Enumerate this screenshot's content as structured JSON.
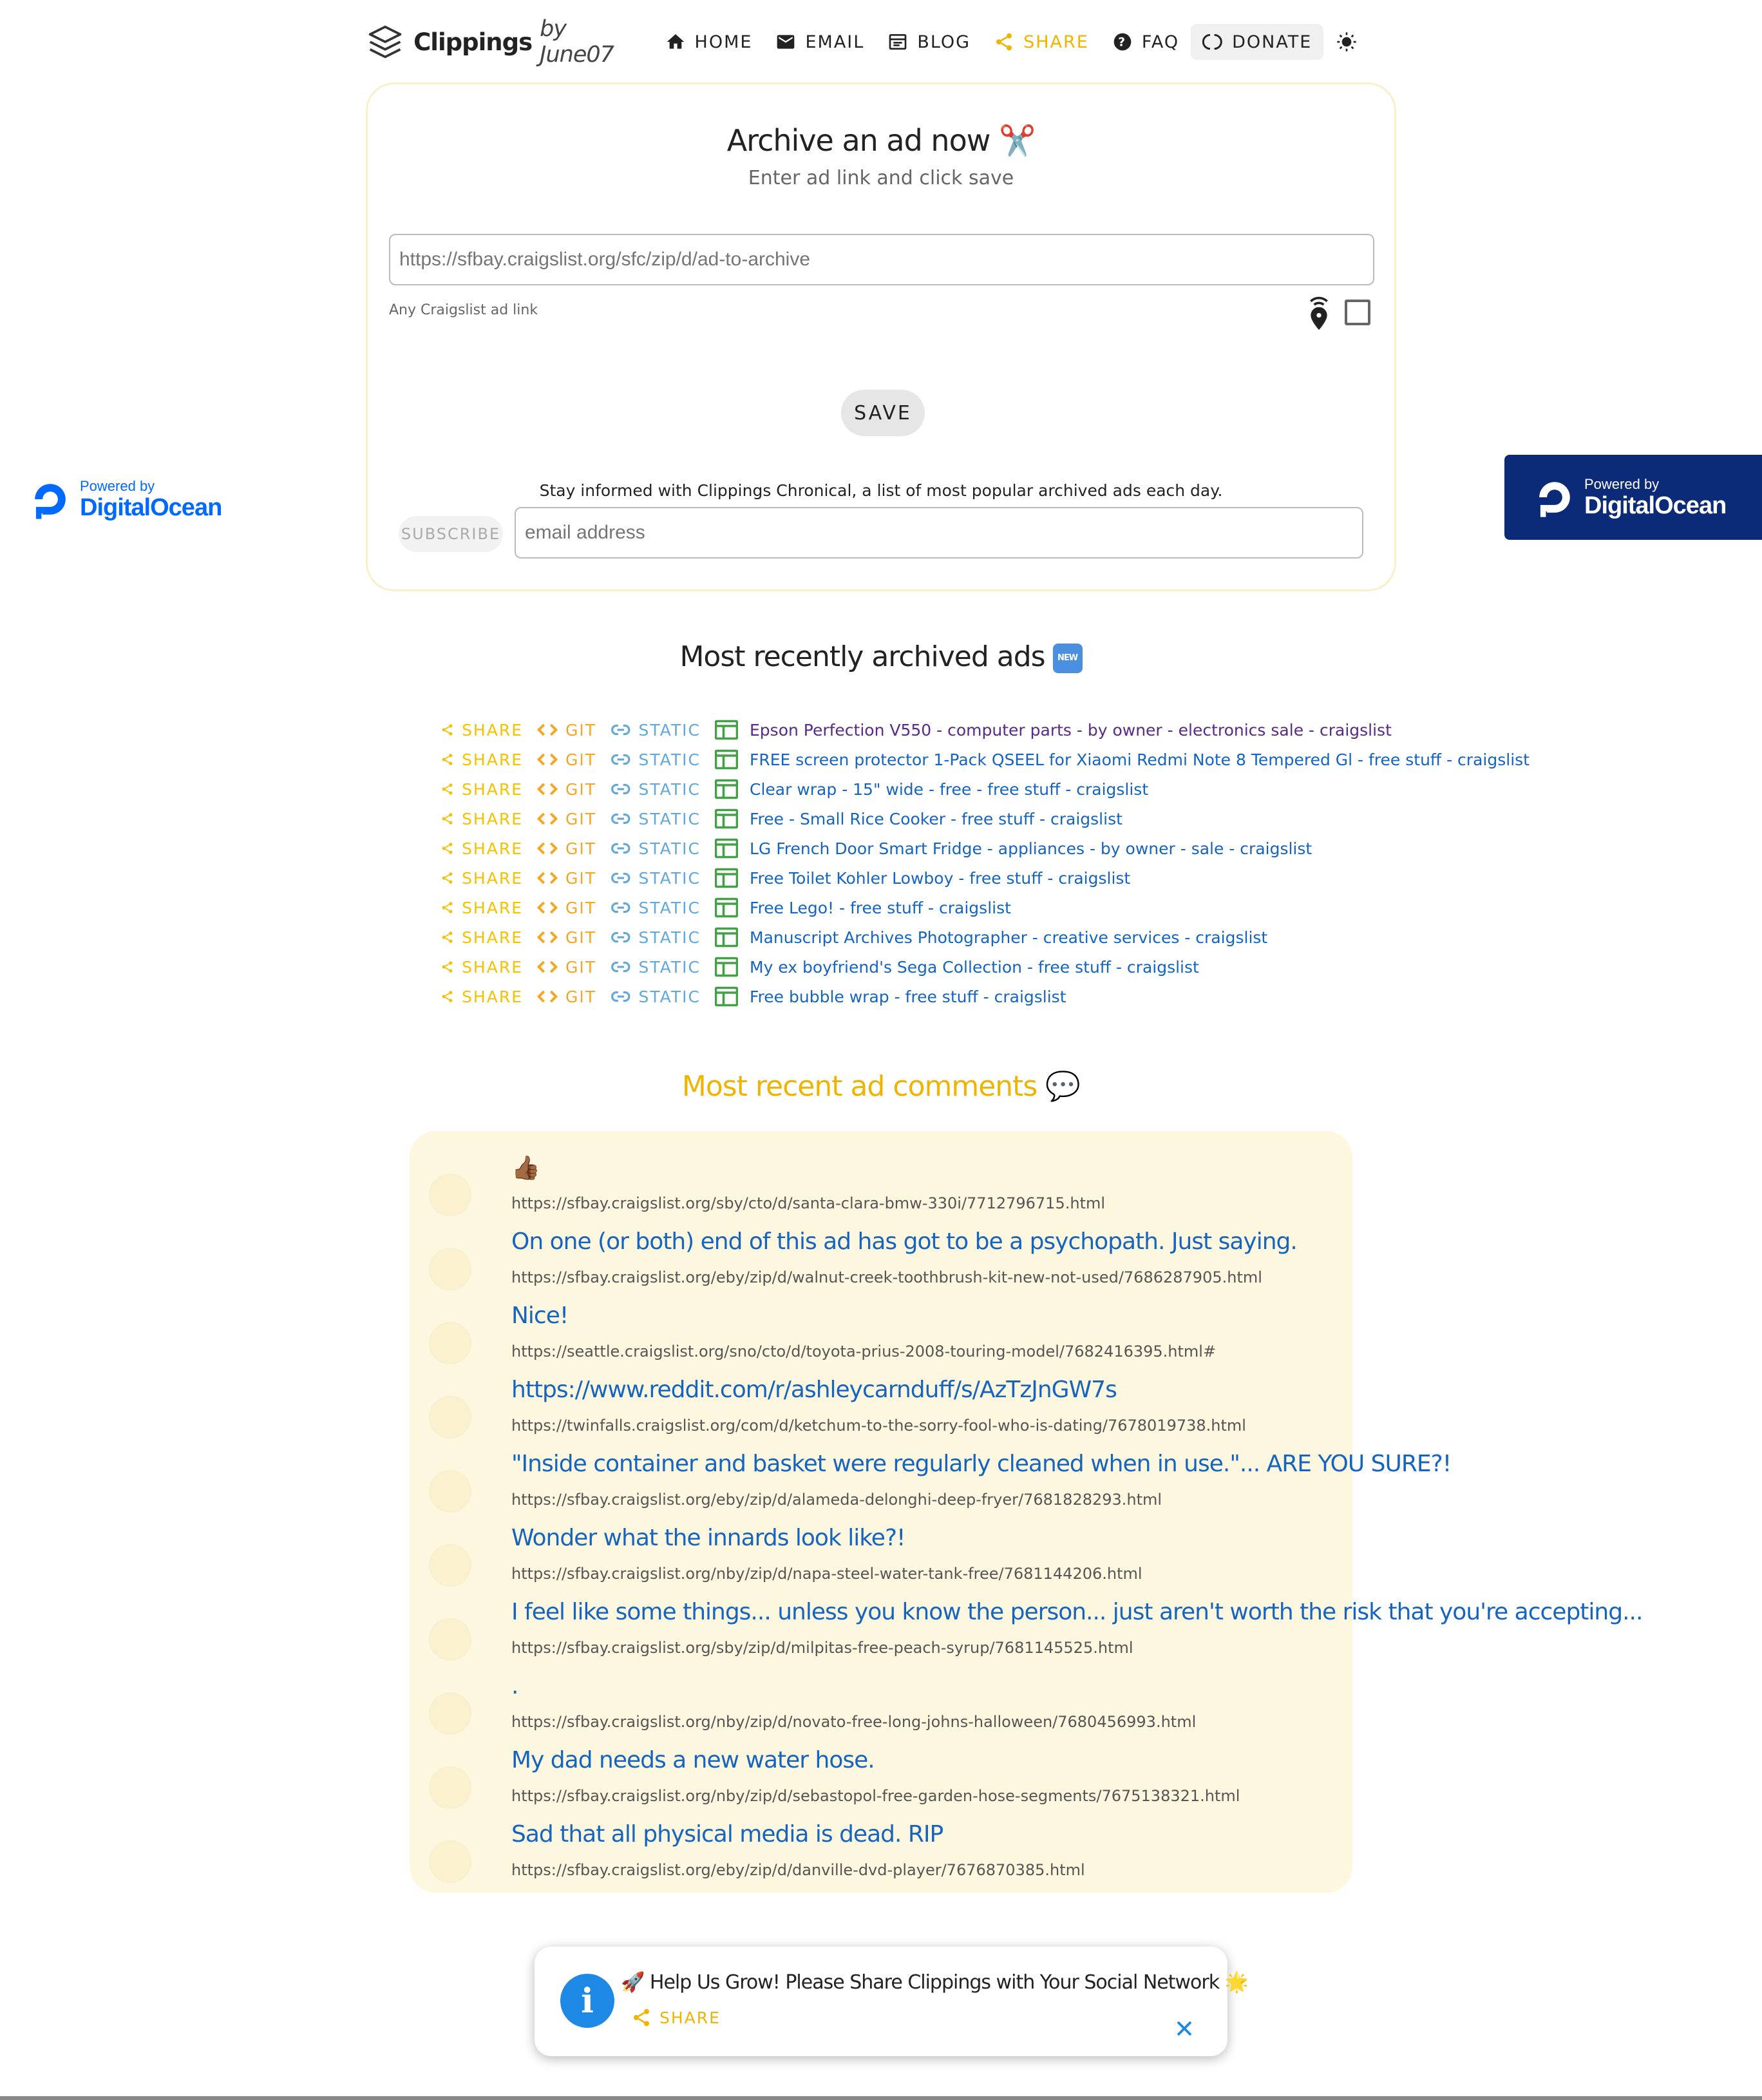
{
  "nav": {
    "brand": "Clippings",
    "brand_by": "by June07",
    "home": "HOME",
    "email": "EMAIL",
    "blog": "BLOG",
    "share": "SHARE",
    "faq": "FAQ",
    "donate": "DONATE",
    "accent_color": "#f0b400"
  },
  "archive": {
    "title": "Archive an ad now ✂️",
    "subtitle": "Enter ad link and click save",
    "url_placeholder": "https://sfbay.craigslist.org/sfc/zip/d/ad-to-archive",
    "help_text": "Any Craigslist ad link",
    "save_label": "SAVE",
    "newsletter_text": "Stay informed with Clippings Chronical, a list of most popular archived ads each day.",
    "subscribe_label": "SUBSCRIBE",
    "email_placeholder": "email address"
  },
  "sponsor": {
    "powered_by": "Powered by",
    "name": "DigitalOcean"
  },
  "recent": {
    "title": "Most recently archived ads",
    "badge": "NEW",
    "share_label": "SHARE",
    "git_label": "GIT",
    "static_label": "STATIC",
    "ads": [
      "Epson Perfection V550 - computer parts - by owner - electronics sale - craigslist",
      "FREE screen protector 1-Pack QSEEL for Xiaomi Redmi Note 8 Tempered Gl - free stuff - craigslist",
      "Clear wrap - 15\" wide - free - free stuff - craigslist",
      "Free - Small Rice Cooker - free stuff - craigslist",
      "LG French Door Smart Fridge - appliances - by owner - sale - craigslist",
      "Free Toilet Kohler Lowboy - free stuff - craigslist",
      "Free Lego! - free stuff - craigslist",
      "Manuscript Archives Photographer - creative services - craigslist",
      "My ex boyfriend's Sega Collection - free stuff - craigslist",
      "Free bubble wrap - free stuff - craigslist"
    ]
  },
  "comments": {
    "title": "Most recent ad comments 💬",
    "items": [
      {
        "text": "👍🏾",
        "url": "https://sfbay.craigslist.org/sby/cto/d/santa-clara-bmw-330i/7712796715.html"
      },
      {
        "text": "On one (or both) end of this ad has got to be a psychopath. Just saying.",
        "url": "https://sfbay.craigslist.org/eby/zip/d/walnut-creek-toothbrush-kit-new-not-used/7686287905.html"
      },
      {
        "text": "Nice!",
        "url": "https://seattle.craigslist.org/sno/cto/d/toyota-prius-2008-touring-model/7682416395.html#"
      },
      {
        "text": "https://www.reddit.com/r/ashleycarnduff/s/AzTzJnGW7s",
        "url": "https://twinfalls.craigslist.org/com/d/ketchum-to-the-sorry-fool-who-is-dating/7678019738.html"
      },
      {
        "text": "\"Inside container and basket were regularly cleaned when in use.\"... ARE YOU SURE?!",
        "url": "https://sfbay.craigslist.org/eby/zip/d/alameda-delonghi-deep-fryer/7681828293.html"
      },
      {
        "text": "Wonder what the innards look like?!",
        "url": "https://sfbay.craigslist.org/nby/zip/d/napa-steel-water-tank-free/7681144206.html"
      },
      {
        "text": "I feel like some things... unless you know the person... just aren't worth the risk that you're accepting...",
        "url": "https://sfbay.craigslist.org/sby/zip/d/milpitas-free-peach-syrup/7681145525.html"
      },
      {
        "text": ".",
        "url": "https://sfbay.craigslist.org/nby/zip/d/novato-free-long-johns-halloween/7680456993.html"
      },
      {
        "text": "My dad needs a new water hose.",
        "url": "https://sfbay.craigslist.org/nby/zip/d/sebastopol-free-garden-hose-segments/7675138321.html"
      },
      {
        "text": "Sad that all physical media is dead. RIP",
        "url": "https://sfbay.craigslist.org/eby/zip/d/danville-dvd-player/7676870385.html"
      }
    ]
  },
  "toast": {
    "message": "🚀 Help Us Grow! Please Share Clippings with Your Social Network 🌟",
    "share_label": "SHARE"
  }
}
